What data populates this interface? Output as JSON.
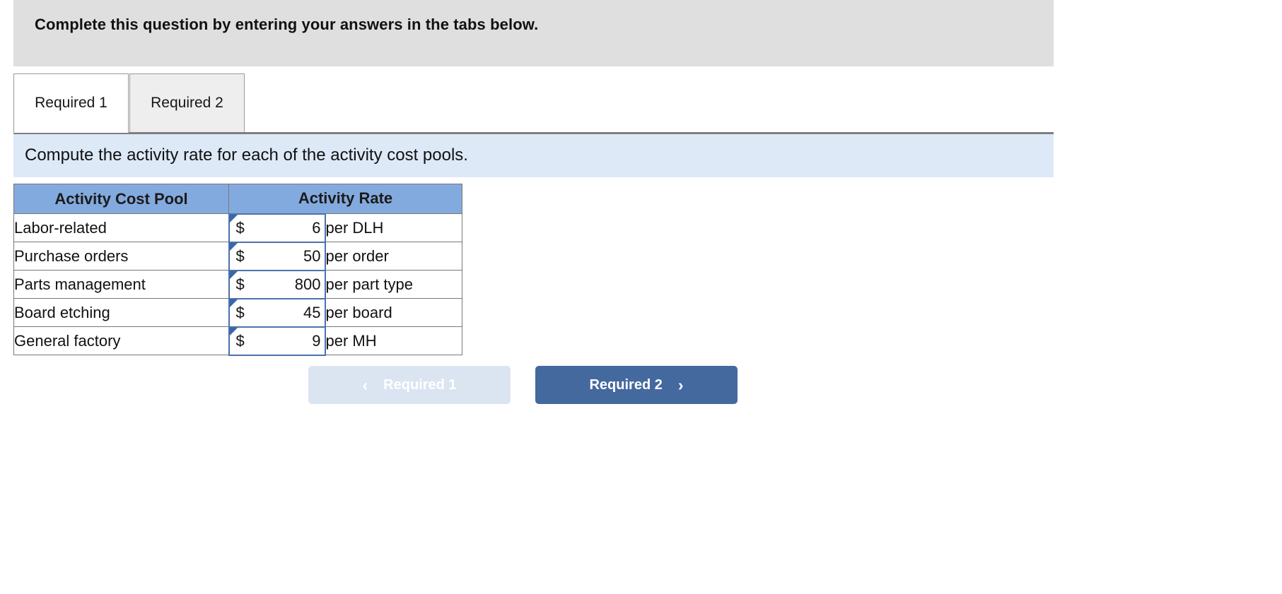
{
  "banner": {
    "message": "Complete this question by entering your answers in the tabs below."
  },
  "tabs": [
    {
      "label": "Required 1",
      "active": true
    },
    {
      "label": "Required 2",
      "active": false
    }
  ],
  "requirement": {
    "text": "Compute the activity rate for each of the activity cost pools."
  },
  "table": {
    "headers": [
      "Activity Cost Pool",
      "Activity Rate"
    ],
    "rows": [
      {
        "pool": "Labor-related",
        "currency": "$",
        "amount": "6",
        "unit": "per DLH"
      },
      {
        "pool": "Purchase orders",
        "currency": "$",
        "amount": "50",
        "unit": "per order"
      },
      {
        "pool": "Parts management",
        "currency": "$",
        "amount": "800",
        "unit": "per part type"
      },
      {
        "pool": "Board etching",
        "currency": "$",
        "amount": "45",
        "unit": "per board"
      },
      {
        "pool": "General factory",
        "currency": "$",
        "amount": "9",
        "unit": "per MH"
      }
    ]
  },
  "nav": {
    "prev_label": "Required 1",
    "prev_icon": "chevron-left-icon",
    "prev_glyph": "‹",
    "next_label": "Required 2",
    "next_icon": "chevron-right-icon",
    "next_glyph": "›"
  },
  "colors": {
    "banner_gray": "#dfdfdf",
    "requirement_blue": "#dde9f7",
    "table_header_blue": "#83aade",
    "input_border_blue": "#4a72ad",
    "flag_blue": "#3a66a8",
    "next_button_blue": "#44699f",
    "prev_button_blue": "#dbe5f1"
  }
}
